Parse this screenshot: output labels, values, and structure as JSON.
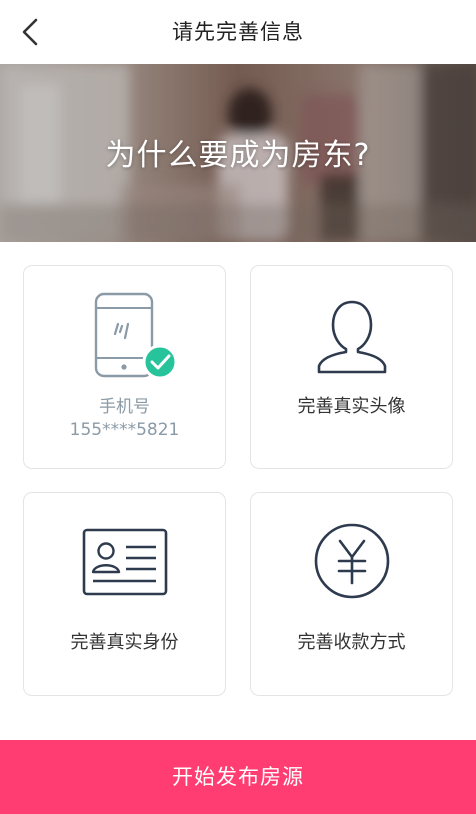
{
  "nav": {
    "title": "请先完善信息",
    "back_icon": "chevron-left-icon"
  },
  "banner": {
    "text": "为什么要成为房东?"
  },
  "cards": [
    {
      "icon": "phone-icon",
      "label": "手机号",
      "value": "155****5821",
      "verified": true
    },
    {
      "icon": "user-avatar-icon",
      "label": "完善真实头像"
    },
    {
      "icon": "id-card-icon",
      "label": "完善真实身份"
    },
    {
      "icon": "yuan-icon",
      "label": "完善收款方式"
    }
  ],
  "cta": {
    "label": "开始发布房源"
  },
  "colors": {
    "accent": "#ff3d72",
    "icon_stroke": "#2e3b4e",
    "verified_badge": "#27c49b",
    "muted_text": "#8a9aa6"
  }
}
